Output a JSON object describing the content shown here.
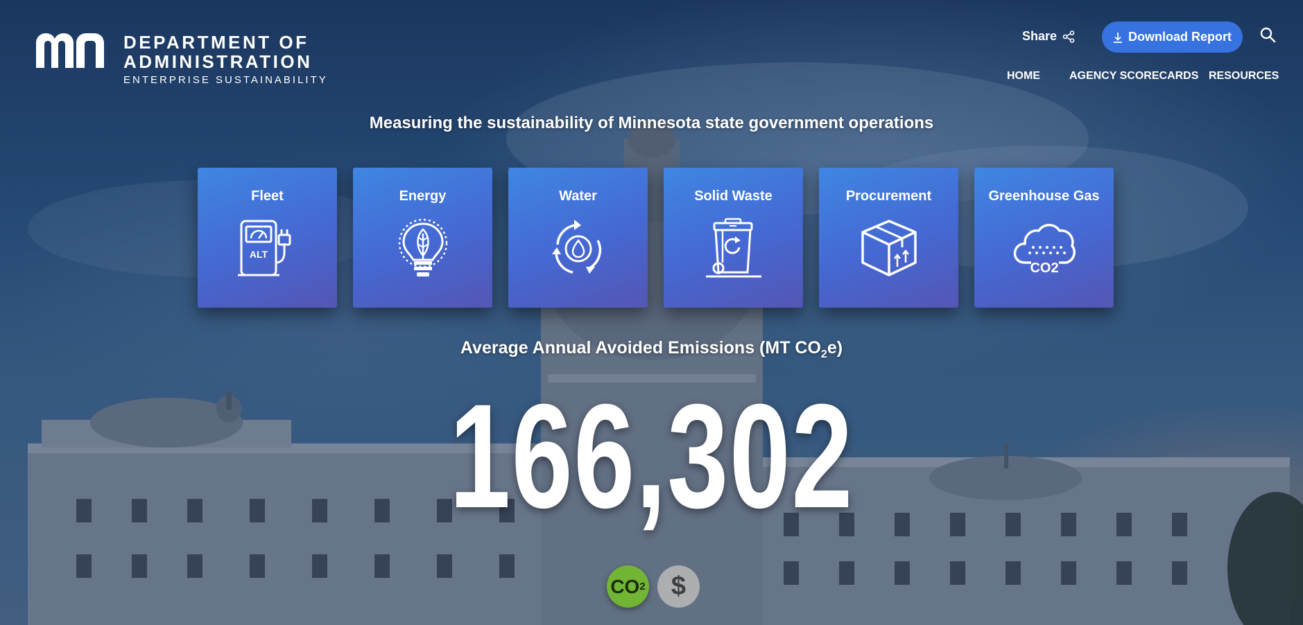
{
  "logo": {
    "mark": "mn",
    "line1": "DEPARTMENT OF",
    "line2": "ADMINISTRATION",
    "line3": "ENTERPRISE SUSTAINABILITY"
  },
  "header": {
    "share_label": "Share",
    "download_label": "Download Report",
    "accent_color": "#3672e0"
  },
  "nav": {
    "items": [
      {
        "label": "HOME"
      },
      {
        "label": "AGENCY SCORECARDS"
      },
      {
        "label": "RESOURCES"
      }
    ]
  },
  "hero": {
    "tagline": "Measuring the sustainability of Minnesota state government operations"
  },
  "tiles": [
    {
      "label": "Fleet",
      "icon": "fleet-ev-charger-icon",
      "icon_text": "ALT"
    },
    {
      "label": "Energy",
      "icon": "lightbulb-leaf-icon"
    },
    {
      "label": "Water",
      "icon": "water-cycle-icon"
    },
    {
      "label": "Solid Waste",
      "icon": "recycling-bin-icon"
    },
    {
      "label": "Procurement",
      "icon": "package-box-icon"
    },
    {
      "label": "Greenhouse Gas",
      "icon": "co2-cloud-icon",
      "icon_text": "CO2"
    }
  ],
  "metric": {
    "label_prefix": "Average Annual Avoided Emissions (MT CO",
    "label_sub": "2",
    "label_suffix": "e)",
    "value": "166,302"
  },
  "toggles": {
    "co2": {
      "text": "CO",
      "sub": "2",
      "color": "#72b534",
      "active": true
    },
    "cost": {
      "text": "$",
      "color": "#b5b5b5",
      "active": false
    }
  }
}
